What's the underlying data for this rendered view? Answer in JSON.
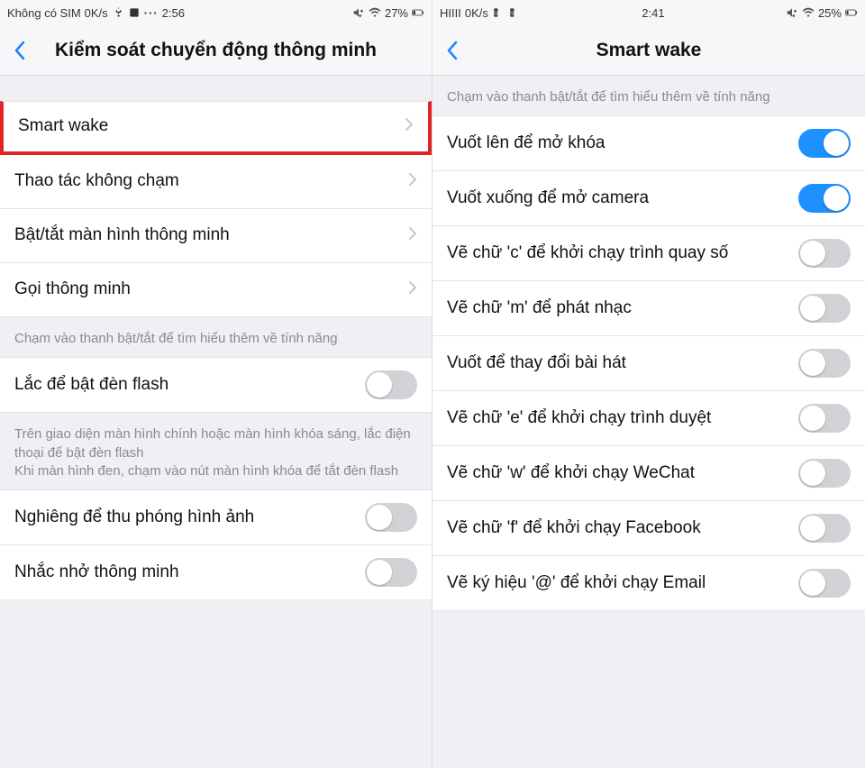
{
  "left": {
    "status": {
      "carrier": "Không có SIM",
      "net": "0K/s",
      "time": "2:56",
      "battery": "27%"
    },
    "title": "Kiểm soát chuyển động thông minh",
    "nav_items": [
      {
        "label": "Smart wake",
        "highlighted": true
      },
      {
        "label": "Thao tác không chạm"
      },
      {
        "label": "Bật/tắt màn hình thông minh"
      },
      {
        "label": "Gọi thông minh"
      }
    ],
    "hint1": "Chạm vào thanh bật/tắt để tìm hiểu thêm về tính năng",
    "toggles1": [
      {
        "label": "Lắc để bật đèn flash",
        "on": false
      }
    ],
    "hint2": "Trên giao diện màn hình chính hoặc màn hình khóa sáng, lắc điện thoại để bật đèn flash\nKhi màn hình đen, chạm vào nút màn hình khóa để tắt đèn flash",
    "toggles2": [
      {
        "label": "Nghiêng để thu phóng hình ảnh",
        "on": false
      },
      {
        "label": "Nhắc nhở thông minh",
        "on": false
      }
    ]
  },
  "right": {
    "status": {
      "carrier": "HIIII",
      "net": "0K/s",
      "time": "2:41",
      "battery": "25%"
    },
    "title": "Smart wake",
    "hint": "Chạm vào thanh bật/tắt để tìm hiểu thêm về tính năng",
    "toggles": [
      {
        "label": "Vuốt lên để mở khóa",
        "on": true
      },
      {
        "label": "Vuốt xuống để mở camera",
        "on": true
      },
      {
        "label": "Vẽ chữ 'c' để khởi chạy trình quay số",
        "on": false
      },
      {
        "label": "Vẽ chữ 'm' để phát nhạc",
        "on": false
      },
      {
        "label": "Vuốt để thay đổi bài hát",
        "on": false
      },
      {
        "label": "Vẽ chữ 'e' để khởi chạy trình duyệt",
        "on": false
      },
      {
        "label": "Vẽ chữ 'w' để khởi chạy WeChat",
        "on": false
      },
      {
        "label": "Vẽ chữ 'f' để khởi chạy Facebook",
        "on": false
      },
      {
        "label": "Vẽ ký hiệu '@' để khởi chạy Email",
        "on": false
      }
    ]
  }
}
